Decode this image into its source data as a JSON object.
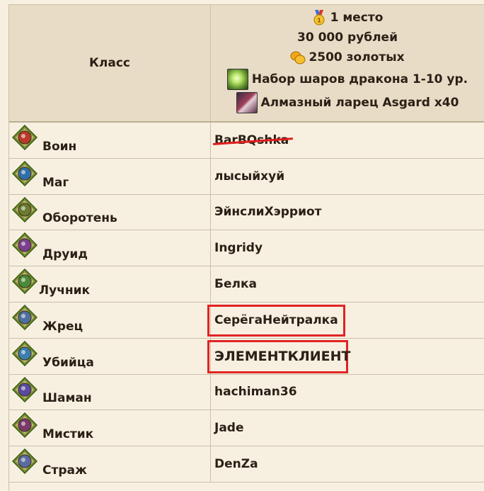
{
  "header": {
    "class_title": "Класс",
    "prize": {
      "place": "1 место",
      "rubles": "30 000 рублей",
      "gold": "2500 золотых",
      "item1": "Набор шаров дракона 1-10 ур.",
      "item2": "Алмазный ларец Asgard x40"
    }
  },
  "rows": [
    {
      "class": "Воин",
      "player": "BarBQshka",
      "icon": "warrior-class-icon",
      "struck": true
    },
    {
      "class": "Маг",
      "player": "лысыйхуй",
      "icon": "mage-class-icon"
    },
    {
      "class": "Оборотень",
      "player": "ЭйнслиХэрриот",
      "icon": "werebeast-class-icon"
    },
    {
      "class": "Друид",
      "player": "Ingridy",
      "icon": "druid-class-icon"
    },
    {
      "class": "Лучник",
      "player": "Белка",
      "icon": "archer-class-icon"
    },
    {
      "class": "Жрец",
      "player": "СерёгаНейтралка",
      "icon": "priest-class-icon",
      "highlighted": true
    },
    {
      "class": "Убийца",
      "player": "ЭЛЕМЕНТКЛИЕНТ",
      "icon": "assassin-class-icon",
      "highlighted": true
    },
    {
      "class": "Шаман",
      "player": "hachiman36",
      "icon": "shaman-class-icon"
    },
    {
      "class": "Мистик",
      "player": "Jade",
      "icon": "mystic-class-icon"
    },
    {
      "class": "Страж",
      "player": "DenZa",
      "icon": "guardian-class-icon"
    }
  ],
  "colors": {
    "background": "#f7f0e1",
    "header_bg": "#e8dcc6",
    "highlight": "#e02424",
    "icon_frame": "#7a9a3a"
  },
  "icons": {
    "medal": "medal-icon",
    "coins": "gold-coins-icon",
    "orb": "dragon-orb-icon",
    "chest": "diamond-chest-icon"
  }
}
